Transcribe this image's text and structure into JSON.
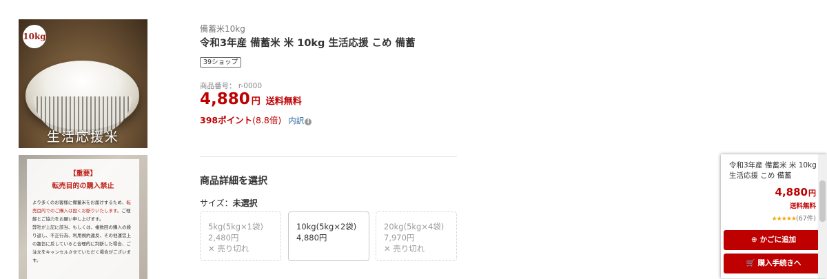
{
  "gallery": {
    "main_badge": "10kg",
    "main_caption": "生活応援米",
    "notice_title": "【重要】",
    "notice_subtitle": "転売目的の購入禁止",
    "notice_body_1": "より多くのお客様に備蓄米をお届けするため、",
    "notice_body_red": "転売目的でのご購入は固くお断りいたします。",
    "notice_body_2": "ご理解とご協力をお願い申し上げます。",
    "notice_body_3": "弊社が上記に該当、もしくは、複数回の購入の繰り返し、不正行為、利用規約違反、その他運営上の趣旨に反していると合理的に判断した場合、ご注文をキャンセルさせていただく場合がございます。"
  },
  "product": {
    "category": "備蓄米10kg",
    "title": "令和3年産 備蓄米 米 10kg 生活応援 こめ 備蓄",
    "shop_tag": "39ショップ",
    "item_number": "商品番号：  r-0000",
    "price": "4,880",
    "currency": "円",
    "shipping": "送料無料",
    "points": "398ポイント",
    "points_rate": "(8.8倍)",
    "points_breakdown": "内訳",
    "info_icon": "i"
  },
  "options": {
    "section_title": "商品詳細を選択",
    "size_label": "サイズ：",
    "size_selected": "未選択",
    "items": [
      {
        "name": "5kg(5kg×1袋)",
        "price": "2,480円",
        "status": "✕ 売り切れ"
      },
      {
        "name": "10kg(5kg×2袋)",
        "price": "4,880円",
        "status": ""
      },
      {
        "name": "20kg(5kg×4袋)",
        "price": "7,970円",
        "status": "✕ 売り切れ"
      }
    ]
  },
  "sidebar": {
    "title": "令和3年産 備蓄米 米 10kg 生活応援 こめ 備蓄",
    "price": "4,880",
    "currency": "円",
    "shipping": "送料無料",
    "rating_stars": "★★★★★",
    "review_count": "(67件)",
    "add_to_cart_icon": "⊕",
    "add_to_cart": "かごに追加",
    "checkout_icon": "🛒",
    "checkout": "購入手続きへ"
  },
  "colors": {
    "accent_red": "#bf0000",
    "link_blue": "#2e6aa6",
    "star_gold": "#f2a600"
  }
}
